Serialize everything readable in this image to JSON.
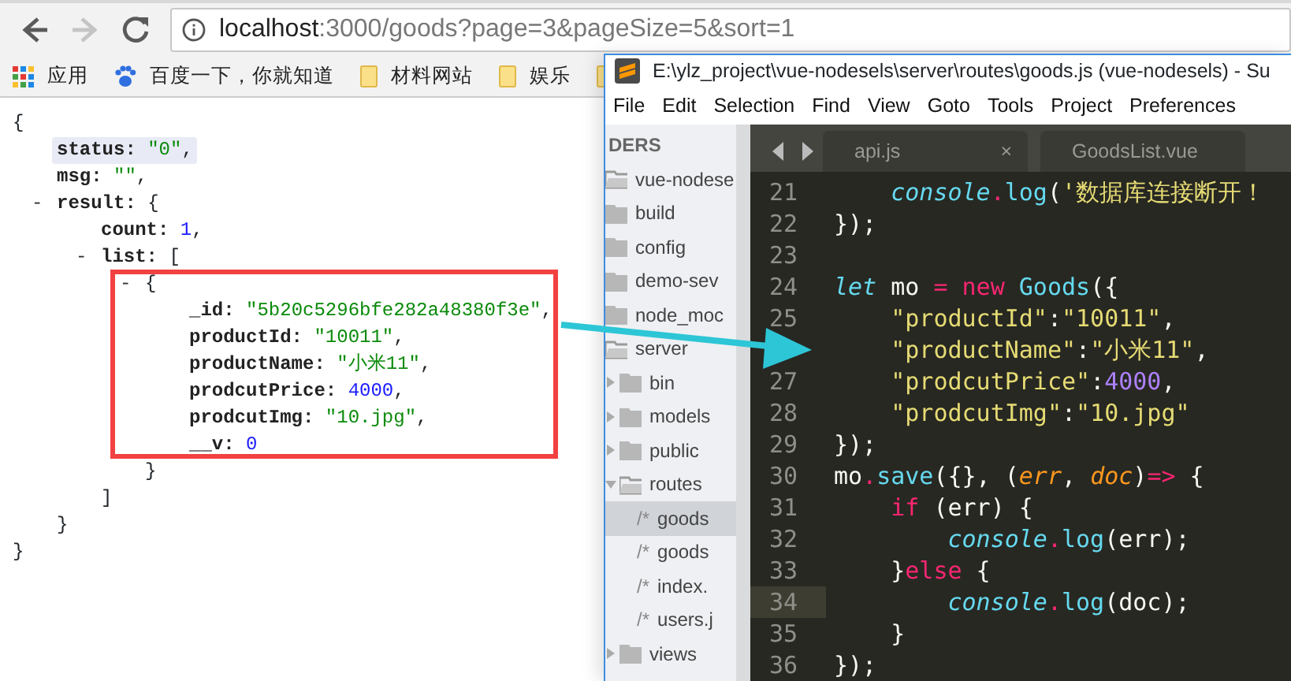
{
  "browser": {
    "nav": [
      {
        "kind": "back",
        "disabled": false
      },
      {
        "kind": "forward",
        "disabled": true
      },
      {
        "kind": "reload",
        "disabled": false
      }
    ],
    "address": {
      "host": "localhost",
      "rest": ":3000/goods?page=3&pageSize=5&sort=1"
    },
    "bookmarks": [
      {
        "kind": "apps",
        "label": "应用"
      },
      {
        "kind": "paw",
        "label": "百度一下，你就知道"
      },
      {
        "kind": "folder",
        "label": "材料网站"
      },
      {
        "kind": "folder",
        "label": "娱乐"
      },
      {
        "kind": "folder"
      }
    ],
    "json_view": {
      "open": "{",
      "close": "}",
      "children": [
        {
          "key": "status",
          "colon": ":",
          "value": "\"0\"",
          "kind": "string",
          "after": ",",
          "highlighted": true
        },
        {
          "key": "msg",
          "colon": ":",
          "value": "\"\"",
          "kind": "string",
          "after": ",",
          "highlighted": false
        },
        {
          "toggle": "-",
          "key": "result",
          "colon": ":",
          "open": "{",
          "close": "}",
          "children": [
            {
              "key": "count",
              "colon": ":",
              "value": "1",
              "kind": "number",
              "after": ",",
              "highlighted": false
            },
            {
              "toggle": "-",
              "key": "list",
              "colon": ":",
              "open": "[",
              "close": "]",
              "children": [
                {
                  "toggle": "-",
                  "open": "{",
                  "close": "}",
                  "children": [
                    {
                      "key": "_id",
                      "colon": ":",
                      "value": "\"5b20c5296bfe282a48380f3e\"",
                      "kind": "string",
                      "after": ",",
                      "highlighted": false
                    },
                    {
                      "key": "productId",
                      "colon": ":",
                      "value": "\"10011\"",
                      "kind": "string",
                      "after": ",",
                      "highlighted": false
                    },
                    {
                      "key": "productName",
                      "colon": ":",
                      "value": "\"小米11\"",
                      "kind": "string",
                      "after": ",",
                      "highlighted": false
                    },
                    {
                      "key": "prodcutPrice",
                      "colon": ":",
                      "value": "4000",
                      "kind": "number",
                      "after": ",",
                      "highlighted": false
                    },
                    {
                      "key": "prodcutImg",
                      "colon": ":",
                      "value": "\"10.jpg\"",
                      "kind": "string",
                      "after": ",",
                      "highlighted": false
                    },
                    {
                      "key": "__v",
                      "colon": ":",
                      "value": "0",
                      "kind": "number",
                      "highlighted": false
                    }
                  ]
                }
              ]
            }
          ]
        }
      ]
    }
  },
  "editor": {
    "title": "E:\\ylz_project\\vue-nodesels\\server\\routes\\goods.js (vue-nodesels) - Su",
    "menu": [
      "File",
      "Edit",
      "Selection",
      "Find",
      "View",
      "Goto",
      "Tools",
      "Project",
      "Preferences"
    ],
    "sidebar": {
      "header": "DERS",
      "items": [
        {
          "kind": "folder",
          "label": "vue-nodese",
          "expanded": true,
          "selected": false,
          "children": [
            {
              "kind": "folder",
              "label": "build",
              "expanded": false,
              "selected": false
            },
            {
              "kind": "folder",
              "label": "config",
              "expanded": false,
              "selected": false
            },
            {
              "kind": "folder",
              "label": "demo-sev",
              "expanded": false,
              "selected": false
            },
            {
              "kind": "folder",
              "label": "node_moc",
              "expanded": false,
              "selected": false
            },
            {
              "kind": "folder",
              "label": "server",
              "expanded": true,
              "selected": false,
              "children": [
                {
                  "kind": "folder",
                  "label": "bin",
                  "expanded": false,
                  "selected": false
                },
                {
                  "kind": "folder",
                  "label": "models",
                  "expanded": false,
                  "selected": false
                },
                {
                  "kind": "folder",
                  "label": "public",
                  "expanded": false,
                  "selected": false
                },
                {
                  "kind": "folder",
                  "label": "routes",
                  "expanded": true,
                  "selected": false,
                  "children": [
                    {
                      "kind": "file",
                      "icon": "/*",
                      "label": "goods",
                      "selected": true
                    },
                    {
                      "kind": "file",
                      "icon": "/*",
                      "label": "goods",
                      "selected": false
                    },
                    {
                      "kind": "file",
                      "icon": "/*",
                      "label": "index.",
                      "selected": false
                    },
                    {
                      "kind": "file",
                      "icon": "/*",
                      "label": "users.j",
                      "selected": false
                    }
                  ]
                },
                {
                  "kind": "folder",
                  "label": "views",
                  "expanded": false,
                  "selected": false
                }
              ]
            }
          ]
        }
      ]
    },
    "tabs": [
      {
        "label": "api.js",
        "close": "×",
        "selected": false
      },
      {
        "label": "GoodsList.vue",
        "selected": false
      }
    ],
    "lines": [
      {
        "number": "21",
        "current": false,
        "tokens": [
          {
            "kind": "support",
            "t": "    console"
          },
          {
            "kind": "keyword",
            "t": "."
          },
          {
            "kind": "func",
            "t": "log"
          },
          {
            "kind": "plain",
            "t": "("
          },
          {
            "kind": "string",
            "t": "'数据库连接断开！"
          }
        ]
      },
      {
        "number": "22",
        "current": false,
        "tokens": [
          {
            "kind": "plain",
            "t": "});"
          }
        ]
      },
      {
        "number": "23",
        "current": false
      },
      {
        "number": "24",
        "current": false,
        "tokens": [
          {
            "kind": "support",
            "t": "let"
          },
          {
            "kind": "plain",
            "t": " mo "
          },
          {
            "kind": "keyword",
            "t": "="
          },
          {
            "kind": "keyword",
            "t": " new "
          },
          {
            "kind": "func",
            "t": "Goods"
          },
          {
            "kind": "plain",
            "t": "({"
          }
        ]
      },
      {
        "number": "25",
        "current": false,
        "tokens": [
          {
            "kind": "string",
            "t": "    \"productId\""
          },
          {
            "kind": "plain",
            "t": ":"
          },
          {
            "kind": "string",
            "t": "\"10011\""
          },
          {
            "kind": "plain",
            "t": ","
          }
        ]
      },
      {
        "current": false,
        "tokens": [
          {
            "kind": "string",
            "t": "    \"productName\""
          },
          {
            "kind": "plain",
            "t": ":"
          },
          {
            "kind": "string",
            "t": "\"小米11\""
          },
          {
            "kind": "plain",
            "t": ","
          }
        ]
      },
      {
        "number": "27",
        "current": false,
        "tokens": [
          {
            "kind": "string",
            "t": "    \"prodcutPrice\""
          },
          {
            "kind": "plain",
            "t": ":"
          },
          {
            "kind": "number",
            "t": "4000"
          },
          {
            "kind": "plain",
            "t": ","
          }
        ]
      },
      {
        "number": "28",
        "current": false,
        "tokens": [
          {
            "kind": "string",
            "t": "    \"prodcutImg\""
          },
          {
            "kind": "plain",
            "t": ":"
          },
          {
            "kind": "string",
            "t": "\"10.jpg\""
          }
        ]
      },
      {
        "number": "29",
        "current": false,
        "tokens": [
          {
            "kind": "plain",
            "t": "});"
          }
        ]
      },
      {
        "number": "30",
        "current": false,
        "tokens": [
          {
            "kind": "plain",
            "t": "mo"
          },
          {
            "kind": "keyword",
            "t": "."
          },
          {
            "kind": "func",
            "t": "save"
          },
          {
            "kind": "plain",
            "t": "({}, ("
          },
          {
            "kind": "param",
            "t": "err"
          },
          {
            "kind": "plain",
            "t": ", "
          },
          {
            "kind": "param",
            "t": "doc"
          },
          {
            "kind": "plain",
            "t": ")"
          },
          {
            "kind": "keyword",
            "t": "=>"
          },
          {
            "kind": "plain",
            "t": " {"
          }
        ]
      },
      {
        "number": "31",
        "current": false,
        "tokens": [
          {
            "kind": "keyword",
            "t": "    if"
          },
          {
            "kind": "plain",
            "t": " (err) {"
          }
        ]
      },
      {
        "number": "32",
        "current": false,
        "tokens": [
          {
            "kind": "support",
            "t": "        console"
          },
          {
            "kind": "keyword",
            "t": "."
          },
          {
            "kind": "func",
            "t": "log"
          },
          {
            "kind": "plain",
            "t": "(err);"
          }
        ]
      },
      {
        "number": "33",
        "current": false,
        "tokens": [
          {
            "kind": "plain",
            "t": "    }"
          },
          {
            "kind": "keyword",
            "t": "else"
          },
          {
            "kind": "plain",
            "t": " {"
          }
        ]
      },
      {
        "number": "34",
        "current": true,
        "tokens": [
          {
            "kind": "support",
            "t": "        console"
          },
          {
            "kind": "keyword",
            "t": "."
          },
          {
            "kind": "func",
            "t": "log"
          },
          {
            "kind": "plain",
            "t": "(doc);"
          }
        ]
      },
      {
        "number": "35",
        "current": false,
        "tokens": [
          {
            "kind": "plain",
            "t": "    }"
          }
        ]
      },
      {
        "number": "36",
        "current": false,
        "tokens": [
          {
            "kind": "plain",
            "t": "});"
          }
        ]
      }
    ]
  }
}
